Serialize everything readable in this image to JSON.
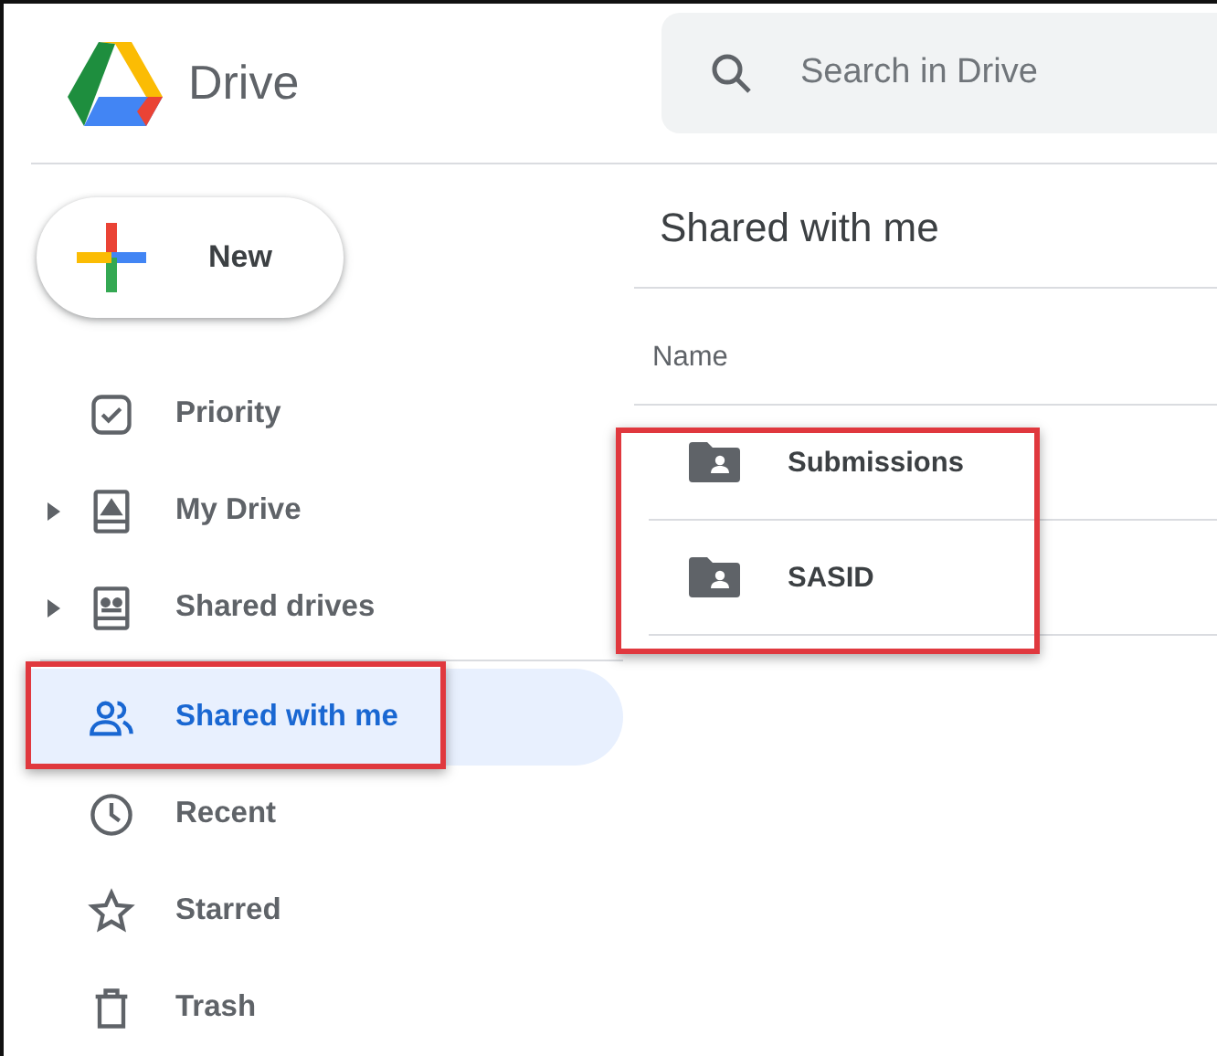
{
  "app": {
    "name": "Drive"
  },
  "search": {
    "placeholder": "Search in Drive"
  },
  "new_button": {
    "label": "New"
  },
  "sidebar": {
    "items": [
      {
        "label": "Priority",
        "expandable": false,
        "selected": false,
        "highlighted": false
      },
      {
        "label": "My Drive",
        "expandable": true,
        "selected": false,
        "highlighted": false
      },
      {
        "label": "Shared drives",
        "expandable": true,
        "selected": false,
        "highlighted": false
      },
      {
        "label": "Shared with me",
        "expandable": false,
        "selected": true,
        "highlighted": true
      },
      {
        "label": "Recent",
        "expandable": false,
        "selected": false,
        "highlighted": false
      },
      {
        "label": "Starred",
        "expandable": false,
        "selected": false,
        "highlighted": false
      },
      {
        "label": "Trash",
        "expandable": false,
        "selected": false,
        "highlighted": false
      }
    ]
  },
  "main": {
    "title": "Shared with me",
    "columns": [
      "Name"
    ],
    "files_highlighted": true,
    "files": [
      {
        "name": "Submissions"
      },
      {
        "name": "SASID"
      }
    ]
  }
}
